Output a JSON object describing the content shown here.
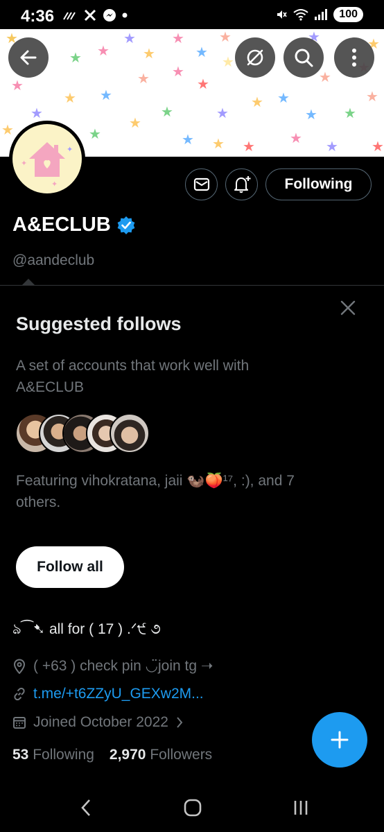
{
  "status_bar": {
    "time": "4:36",
    "battery": "100",
    "icons": [
      "wifi-calling-icon",
      "x-icon",
      "messenger-icon",
      "dot-icon",
      "mute-icon",
      "wifi-icon",
      "signal-icon"
    ]
  },
  "banner": {
    "actions": [
      "back-arrow-icon",
      "grok-icon",
      "search-icon",
      "more-vertical-icon"
    ]
  },
  "profile": {
    "name": "A&ECLUB",
    "handle": "@aandeclub",
    "following_button": "Following",
    "verified": true,
    "bio": "ঌ⁀➷ all for ( 17 ) .ᐟ੯⁠ ૭",
    "location": "( +63 ) check pin ◡̈join tg ➝",
    "link": "t.me/+t6ZZyU_GEXw2M...",
    "joined": "Joined October 2022",
    "following_count": "53",
    "following_label": "Following",
    "followers_count": "2,970",
    "followers_label": "Followers"
  },
  "suggested": {
    "title": "Suggested follows",
    "description": "A set of accounts that work well with A&ECLUB",
    "featuring": "Featuring vihokratana, jaii 🦦🍑¹⁷, :), and 7 others.",
    "follow_all": "Follow all"
  },
  "colors": {
    "accent": "#1d9bf0",
    "background": "#000000",
    "muted_text": "#71767b",
    "avatar_bg": "#fbf3c7",
    "avatar_house": "#f4a6c0"
  }
}
